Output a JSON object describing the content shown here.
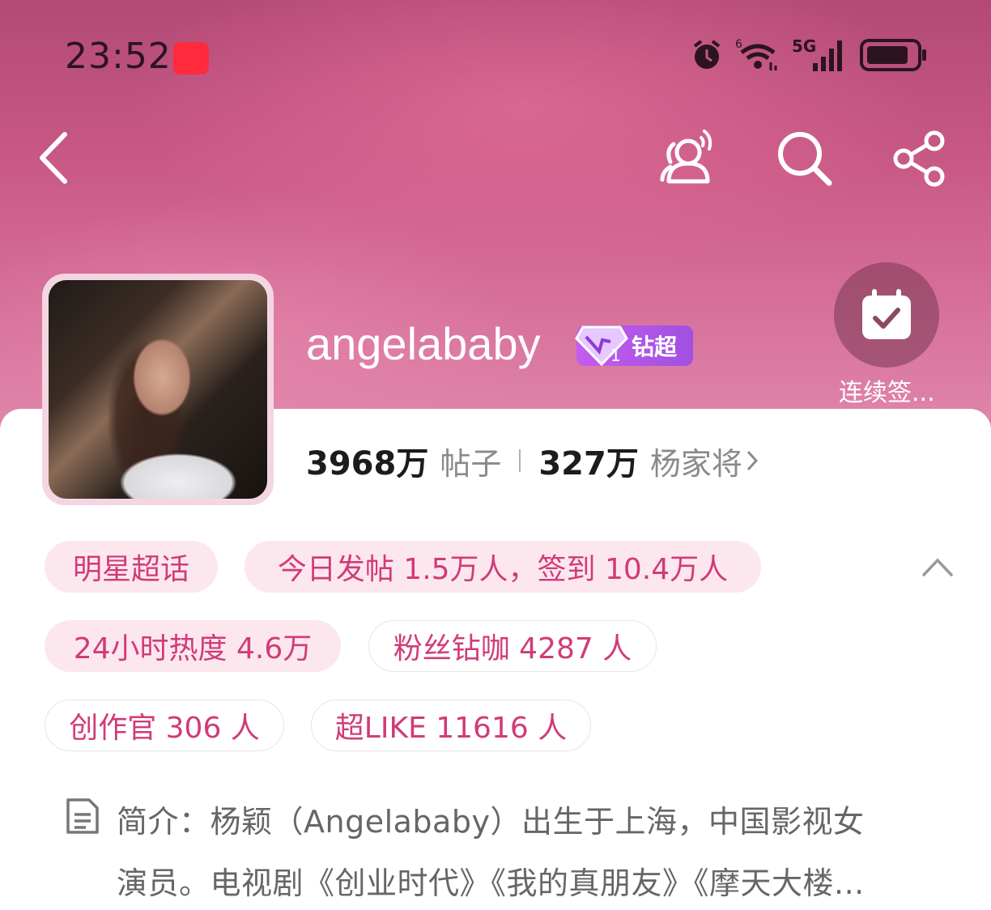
{
  "status_bar": {
    "time": "23:52",
    "network": "5G"
  },
  "profile": {
    "name": "angelababy",
    "badge": "钻超",
    "checkin_label": "连续签...",
    "stats": [
      {
        "value": "3968万",
        "label": "帖子"
      },
      {
        "value": "327万",
        "label": "杨家将"
      }
    ]
  },
  "tags": [
    {
      "text": "明星超话"
    },
    {
      "text": "今日发帖 1.5万人，签到 10.4万人"
    },
    {
      "text": "24小时热度 4.6万"
    },
    {
      "text": "粉丝钻咖 4287 人"
    },
    {
      "text": "创作官 306 人"
    },
    {
      "text": "超LIKE 11616 人"
    }
  ],
  "intro": {
    "line1": "简介：杨颖（Angelababy）出生于上海，中国影视女",
    "line2": "演员。电视剧《创业时代》《我的真朋友》《摩天大楼..."
  },
  "colors": {
    "accent": "#d13b78",
    "hero": "#c85885",
    "tag_fill": "#fde7ef"
  }
}
